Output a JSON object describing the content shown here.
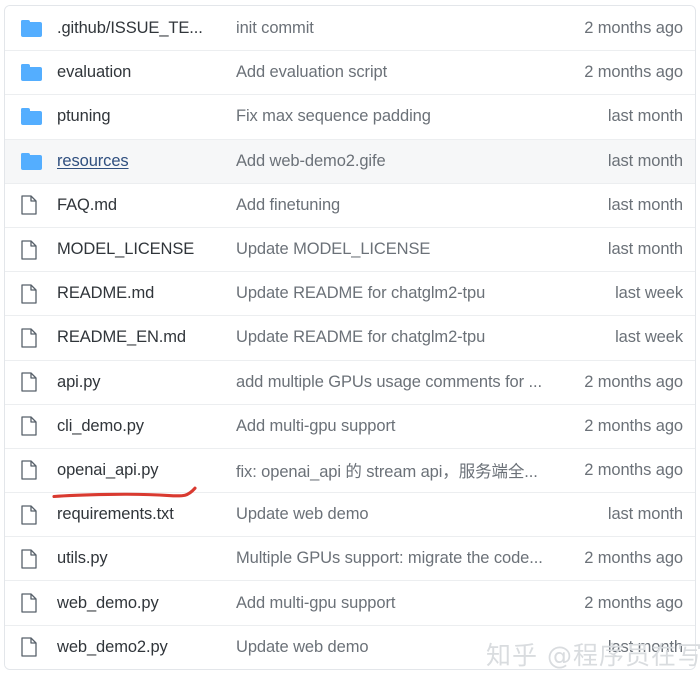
{
  "file_browser": {
    "columns": [
      "name",
      "commit_message",
      "time"
    ],
    "rows": [
      {
        "icon": "folder-icon",
        "type": "folder",
        "name": ".github/ISSUE_TE...",
        "message": "init commit",
        "time": "2 months ago",
        "highlighted": false,
        "link": false
      },
      {
        "icon": "folder-icon",
        "type": "folder",
        "name": "evaluation",
        "message": "Add evaluation script",
        "time": "2 months ago",
        "highlighted": false,
        "link": false
      },
      {
        "icon": "folder-icon",
        "type": "folder",
        "name": "ptuning",
        "message": "Fix max sequence padding",
        "time": "last month",
        "highlighted": false,
        "link": false
      },
      {
        "icon": "folder-icon",
        "type": "folder",
        "name": "resources",
        "message": "Add web-demo2.gife",
        "time": "last month",
        "highlighted": true,
        "link": true
      },
      {
        "icon": "file-icon",
        "type": "file",
        "name": "FAQ.md",
        "message": "Add finetuning",
        "time": "last month",
        "highlighted": false,
        "link": false
      },
      {
        "icon": "file-icon",
        "type": "file",
        "name": "MODEL_LICENSE",
        "message": "Update MODEL_LICENSE",
        "time": "last month",
        "highlighted": false,
        "link": false
      },
      {
        "icon": "file-icon",
        "type": "file",
        "name": "README.md",
        "message": "Update README for chatglm2-tpu",
        "time": "last week",
        "highlighted": false,
        "link": false
      },
      {
        "icon": "file-icon",
        "type": "file",
        "name": "README_EN.md",
        "message": "Update README for chatglm2-tpu",
        "time": "last week",
        "highlighted": false,
        "link": false
      },
      {
        "icon": "file-icon",
        "type": "file",
        "name": "api.py",
        "message": "add multiple GPUs usage comments for ...",
        "time": "2 months ago",
        "highlighted": false,
        "link": false
      },
      {
        "icon": "file-icon",
        "type": "file",
        "name": "cli_demo.py",
        "message": "Add multi-gpu support",
        "time": "2 months ago",
        "highlighted": false,
        "link": false
      },
      {
        "icon": "file-icon",
        "type": "file",
        "name": "openai_api.py",
        "message": "fix: openai_api 的 stream api，服务端全...",
        "time": "2 months ago",
        "highlighted": false,
        "link": false
      },
      {
        "icon": "file-icon",
        "type": "file",
        "name": "requirements.txt",
        "message": "Update web demo",
        "time": "last month",
        "highlighted": false,
        "link": false
      },
      {
        "icon": "file-icon",
        "type": "file",
        "name": "utils.py",
        "message": "Multiple GPUs support: migrate the code...",
        "time": "2 months ago",
        "highlighted": false,
        "link": false
      },
      {
        "icon": "file-icon",
        "type": "file",
        "name": "web_demo.py",
        "message": "Add multi-gpu support",
        "time": "2 months ago",
        "highlighted": false,
        "link": false
      },
      {
        "icon": "file-icon",
        "type": "file",
        "name": "web_demo2.py",
        "message": "Update web demo",
        "time": "last month",
        "highlighted": false,
        "link": false
      }
    ]
  },
  "annotation": {
    "underlined_target": "openai_api.py",
    "color": "#d93a30"
  },
  "watermark": {
    "text": "知乎 @程序员在写作",
    "color": "#d9dcdf"
  },
  "colors": {
    "folder_blue": "#54aeff",
    "file_outline": "#57606a",
    "name_text": "#30353a",
    "muted_text": "#6b7178",
    "link_text": "#2f4f7f",
    "row_divider": "#eceef0",
    "row_highlight": "#f6f7f8",
    "container_border": "#e3e6ea"
  }
}
